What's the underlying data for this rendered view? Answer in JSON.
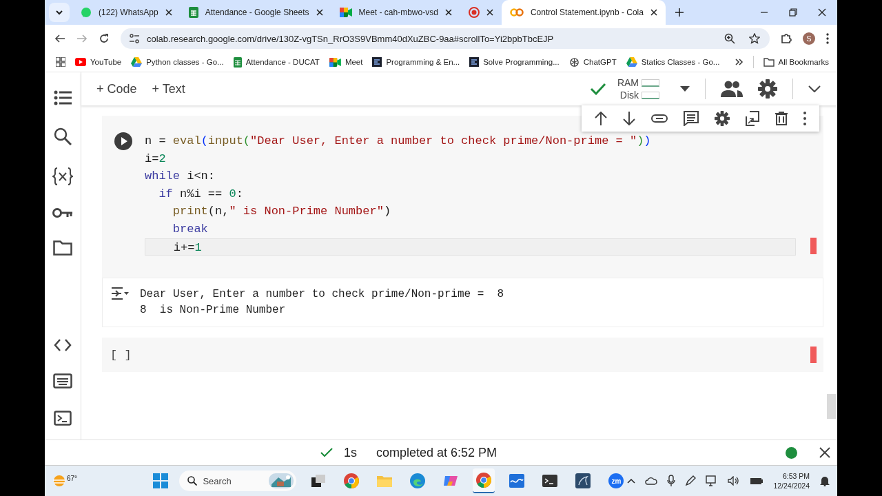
{
  "browser": {
    "tabs": [
      {
        "title": "(122) WhatsApp",
        "kind": "chat",
        "selected": false
      },
      {
        "title": "Attendance - Google Sheets",
        "kind": "sheet",
        "selected": false
      },
      {
        "title": "Meet - cah-mbwo-vsd",
        "kind": "video",
        "selected": false
      },
      {
        "kind": "record",
        "selected": false
      },
      {
        "title": "Control Statement.ipynb - Cola",
        "kind": "loops",
        "selected": true
      }
    ],
    "address": "colab.research.google.com/drive/130Z-vgTSn_RrO3S9VBmm40dXuZBC-9aa#scrollTo=Yi2bpbTbcEJP",
    "avatar": "S",
    "bookmarks": [
      {
        "label": "YouTube",
        "kind": "play"
      },
      {
        "label": "Python classes - Go...",
        "kind": "drive"
      },
      {
        "label": "Attendance - DUCAT",
        "kind": "sheet"
      },
      {
        "label": "Meet",
        "kind": "video"
      },
      {
        "label": "Programming & En...",
        "kind": "dark"
      },
      {
        "label": "Solve Programming...",
        "kind": "dark"
      },
      {
        "label": "ChatGPT",
        "kind": "knot"
      },
      {
        "label": "Statics Classes - Go...",
        "kind": "drive"
      }
    ],
    "all_bookmarks": "All Bookmarks"
  },
  "toolbar": {
    "add_code": "+ Code",
    "add_text": "+ Text",
    "ram": "RAM",
    "disk": "Disk"
  },
  "cells": [
    {
      "kind": "code",
      "lines": [
        {
          "current": false,
          "tokens": [
            {
              "text": "n = ",
              "kind": "plain"
            },
            {
              "text": "eval",
              "kind": "func"
            },
            {
              "text": "(",
              "kind": "paren"
            },
            {
              "text": "input",
              "kind": "func"
            },
            {
              "text": "(",
              "kind": "paren2"
            },
            {
              "text": "\"Dear User, Enter a number to check prime/Non-prime = \"",
              "kind": "string"
            },
            {
              "text": ")",
              "kind": "paren2"
            },
            {
              "text": ")",
              "kind": "paren"
            }
          ]
        },
        {
          "current": false,
          "tokens": [
            {
              "text": "i=",
              "kind": "plain"
            },
            {
              "text": "2",
              "kind": "number"
            }
          ]
        },
        {
          "current": false,
          "tokens": [
            {
              "text": "while",
              "kind": "keyword"
            },
            {
              "text": " i<n:",
              "kind": "plain"
            }
          ]
        },
        {
          "current": false,
          "tokens": [
            {
              "text": "  if",
              "kind": "keyword"
            },
            {
              "text": " n%i == ",
              "kind": "plain"
            },
            {
              "text": "0",
              "kind": "number"
            },
            {
              "text": ":",
              "kind": "plain"
            }
          ]
        },
        {
          "current": false,
          "tokens": [
            {
              "text": "    print",
              "kind": "func"
            },
            {
              "text": "(n,",
              "kind": "plain"
            },
            {
              "text": "\" is Non-Prime Number\"",
              "kind": "string"
            },
            {
              "text": ")",
              "kind": "plain"
            }
          ]
        },
        {
          "current": false,
          "tokens": [
            {
              "text": "    break",
              "kind": "keyword"
            }
          ]
        },
        {
          "current": true,
          "tokens": [
            {
              "text": "    i+=",
              "kind": "plain"
            },
            {
              "text": "1",
              "kind": "number"
            }
          ]
        }
      ],
      "output": [
        "Dear User, Enter a number to check prime/Non-prime =  8",
        "8  is Non-Prime Number"
      ]
    },
    {
      "kind": "empty",
      "run_label": "[ ]"
    }
  ],
  "status_bar": {
    "duration": "1s",
    "message": "completed at 6:52 PM"
  },
  "taskbar": {
    "weather": "67°",
    "search": "Search",
    "apps": [
      {
        "kind": "files",
        "active": false
      },
      {
        "kind": "chrome",
        "active": false
      },
      {
        "kind": "folder",
        "active": false
      },
      {
        "kind": "edge",
        "active": false
      },
      {
        "kind": "copilot",
        "active": false
      },
      {
        "kind": "chrome",
        "active": true
      },
      {
        "kind": "wave",
        "active": false
      },
      {
        "kind": "terminal",
        "active": false
      },
      {
        "kind": "db",
        "active": false
      },
      {
        "kind": "zm",
        "active": false
      }
    ],
    "zm_label": "zm",
    "time": "6:53 PM",
    "date": "12/24/2024"
  }
}
